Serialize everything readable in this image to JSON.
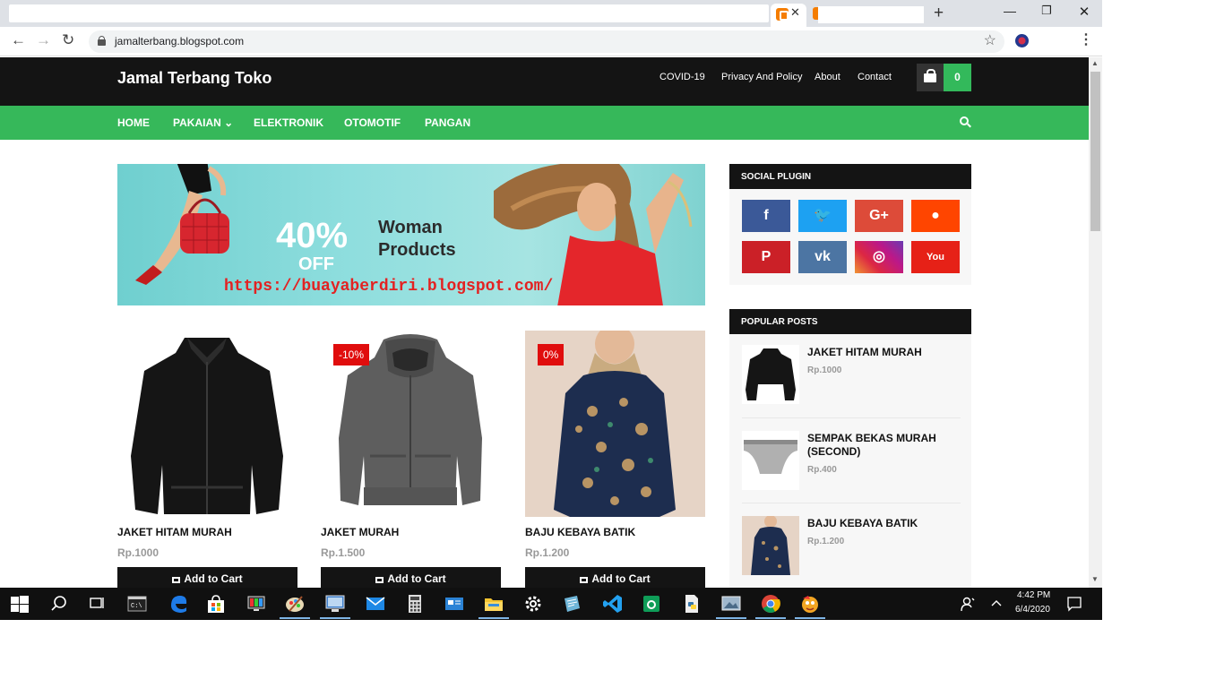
{
  "browser": {
    "url": "jamalterbang.blogspot.com",
    "new_tab_glyph": "+",
    "tab_close_glyph": "✕",
    "win_min": "—",
    "win_max": "❐",
    "win_close": "✕",
    "back": "←",
    "forward": "→",
    "reload": "↻",
    "star": "☆",
    "menu": "⋮"
  },
  "site": {
    "logo": "Jamal Terbang Toko",
    "top_links": [
      "COVID-19",
      "Privacy And Policy",
      "About",
      "Contact"
    ],
    "cart_count": "0",
    "nav": [
      "HOME",
      "PAKAIAN",
      "ELEKTRONIK",
      "OTOMOTIF",
      "PANGAN"
    ],
    "nav_dropdown_glyph": "⌄"
  },
  "banner": {
    "percent": "40%",
    "off": "OFF",
    "title": "Woman Products",
    "url_text": "https://buayaberdiri.blogspot.com/"
  },
  "products": [
    {
      "title": "JAKET HITAM MURAH",
      "price": "Rp.1000",
      "discount": "",
      "button": "Add to Cart"
    },
    {
      "title": "JAKET MURAH",
      "price": "Rp.1.500",
      "discount": "-10%",
      "button": "Add to Cart"
    },
    {
      "title": "BAJU KEBAYA BATIK",
      "price": "Rp.1.200",
      "discount": "0%",
      "button": "Add to Cart"
    }
  ],
  "sidebar": {
    "social_title": "SOCIAL PLUGIN",
    "social": [
      {
        "icon": "facebook-icon",
        "glyph": "f",
        "color": "#3b5998"
      },
      {
        "icon": "twitter-icon",
        "glyph": "🐦",
        "color": "#1da1f2"
      },
      {
        "icon": "google-plus-icon",
        "glyph": "G+",
        "color": "#dd4b39"
      },
      {
        "icon": "reddit-icon",
        "glyph": "●",
        "color": "#ff4500"
      },
      {
        "icon": "pinterest-icon",
        "glyph": "P",
        "color": "#cb2027"
      },
      {
        "icon": "vk-icon",
        "glyph": "vk",
        "color": "#4c75a3"
      },
      {
        "icon": "instagram-icon",
        "glyph": "◎",
        "color": "#c13584"
      },
      {
        "icon": "youtube-icon",
        "glyph": "You",
        "color": "#e62117"
      }
    ],
    "popular_title": "POPULAR POSTS",
    "popular": [
      {
        "title": "JAKET HITAM MURAH",
        "price": "Rp.1000"
      },
      {
        "title": "SEMPAK BEKAS MURAH (SECOND)",
        "price": "Rp.400"
      },
      {
        "title": "BAJU KEBAYA BATIK",
        "price": "Rp.1.200"
      }
    ]
  },
  "taskbar": {
    "time": "4:42 PM",
    "date": "6/4/2020"
  }
}
